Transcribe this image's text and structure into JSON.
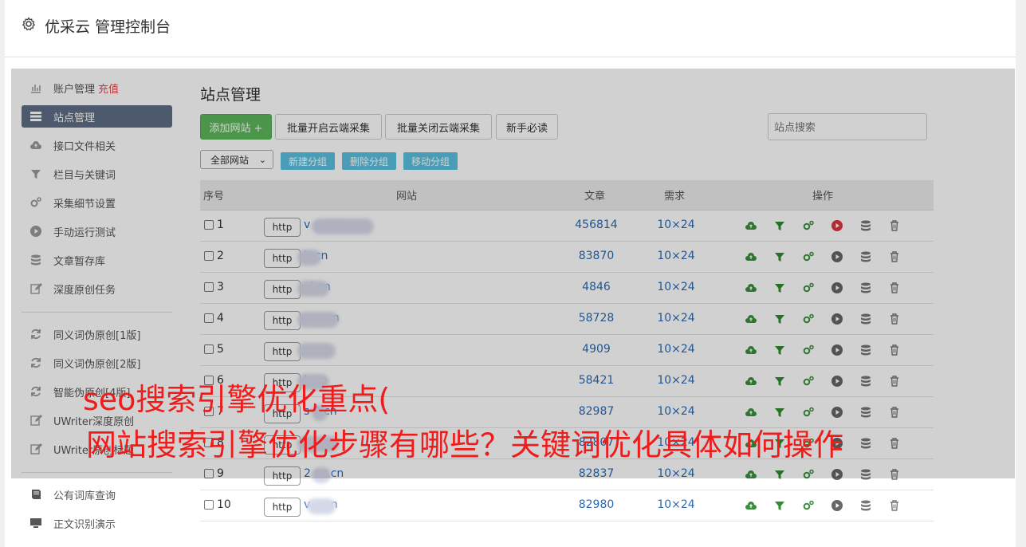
{
  "header": {
    "title": "优采云 管理控制台"
  },
  "sidebar": {
    "items": [
      {
        "label": "账户管理",
        "extra": "充值"
      },
      {
        "label": "站点管理"
      },
      {
        "label": "接口文件相关"
      },
      {
        "label": "栏目与关键词"
      },
      {
        "label": "采集细节设置"
      },
      {
        "label": "手动运行测试"
      },
      {
        "label": "文章暂存库"
      },
      {
        "label": "深度原创任务"
      },
      {
        "label": "同义词伪原创[1版]"
      },
      {
        "label": "同义词伪原创[2版]"
      },
      {
        "label": "智能伪原创[4版]"
      },
      {
        "label": "UWriter深度原创"
      },
      {
        "label": "UWriter原创标题"
      },
      {
        "label": "公有词库查询"
      },
      {
        "label": "正文识别演示"
      }
    ]
  },
  "main": {
    "title": "站点管理",
    "add_site_label": "添加网站 +",
    "batch_open_label": "批量开启云端采集",
    "batch_close_label": "批量关闭云端采集",
    "newbie_label": "新手必读",
    "search_placeholder": "站点搜索",
    "group_select": "全部网站",
    "new_group_label": "新建分组",
    "delete_group_label": "删除分组",
    "move_group_label": "移动分组"
  },
  "table": {
    "headers": {
      "index": "序号",
      "site": "网站",
      "articles": "文章",
      "demand": "需求",
      "ops": "操作"
    },
    "rows": [
      {
        "index": "1",
        "http": "http",
        "site": "v            .com",
        "articles": "456814",
        "demand": "10×24"
      },
      {
        "index": "2",
        "http": "http",
        "site": "       it.cn",
        "articles": "83870",
        "demand": "10×24"
      },
      {
        "index": "3",
        "http": "http",
        "site": "       ni.cn",
        "articles": "4846",
        "demand": "10×24"
      },
      {
        "index": "4",
        "http": "http",
        "site": "          pay.cn",
        "articles": "58728",
        "demand": "10×24"
      },
      {
        "index": "5",
        "http": "http",
        "site": "          s.cn",
        "articles": "4909",
        "demand": "10×24"
      },
      {
        "index": "6",
        "http": "http",
        "site": "     k.cn",
        "articles": "58421",
        "demand": "10×24"
      },
      {
        "index": "7",
        "http": "http",
        "site": "s   9.cn",
        "articles": "82987",
        "demand": "10×24"
      },
      {
        "index": "8",
        "http": "http",
        "site": "       y.cn",
        "articles": "82807",
        "demand": "10×24"
      },
      {
        "index": "9",
        "http": "http",
        "site": "2     az.cn",
        "articles": "82837",
        "demand": "10×24"
      },
      {
        "index": "10",
        "http": "http",
        "site": "v     p.cn",
        "articles": "82980",
        "demand": "10×24"
      }
    ]
  },
  "overlay": {
    "line1": "seo搜索引擎优化重点(",
    "line2": "网站搜索引擎优化步骤有哪些？关键词优化具体如何操作"
  },
  "colors": {
    "accent_green": "#5cb85c",
    "info_blue": "#5bc0de",
    "active_nav": "#5f6d85",
    "overlay_text": "#f01b1b"
  }
}
